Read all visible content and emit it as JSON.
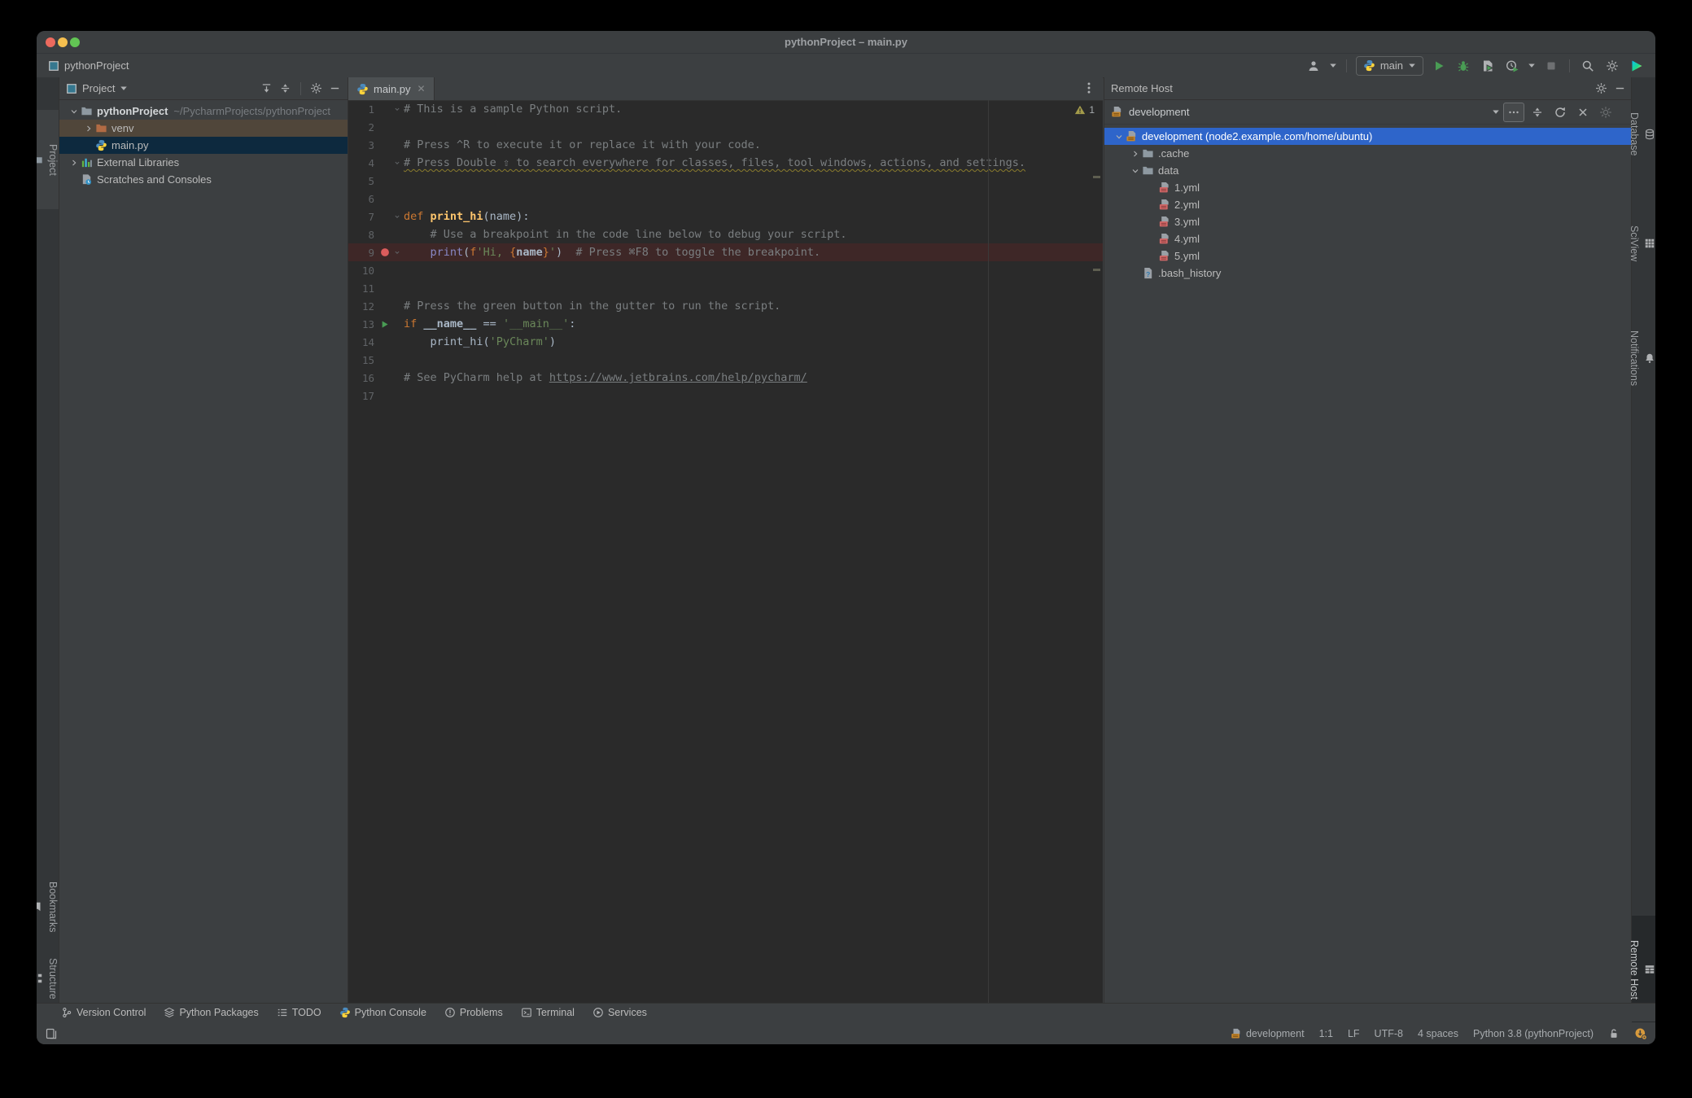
{
  "window": {
    "title": "pythonProject – main.py"
  },
  "breadcrumb": {
    "project": "pythonProject"
  },
  "toolbar": {
    "run_config": "main",
    "icons": [
      "user-icon",
      "python-icon",
      "run-icon",
      "debug-icon",
      "run-with-coverage-icon",
      "profiler-icon",
      "stop-icon",
      "search-everywhere-icon",
      "settings-gear-icon",
      "ide-logo-icon"
    ]
  },
  "left_stripe": {
    "items": [
      {
        "label": "Project",
        "icon": "folder-icon"
      },
      {
        "label": "Bookmarks",
        "icon": "bookmark-icon"
      },
      {
        "label": "Structure",
        "icon": "structure-icon"
      }
    ]
  },
  "right_stripe": {
    "items": [
      {
        "label": "Database",
        "icon": "database-icon"
      },
      {
        "label": "SciView",
        "icon": "grid-icon"
      },
      {
        "label": "Notifications",
        "icon": "bell-icon"
      }
    ],
    "bottom": [
      {
        "label": "Remote Host",
        "icon": "remote-host-icon"
      }
    ]
  },
  "project_panel": {
    "title": "Project",
    "header_icons": [
      "expand-all-icon",
      "collapse-all-icon",
      "settings-gear-icon",
      "hide-icon"
    ],
    "tree": [
      {
        "label": "pythonProject",
        "suffix": "~/PycharmProjects/pythonProject",
        "level": 0,
        "chevron": "down",
        "icon": "folder",
        "bold": true,
        "row": ""
      },
      {
        "label": "venv",
        "suffix": "",
        "level": 1,
        "chevron": "right",
        "icon": "folder-ex",
        "bold": false,
        "row": "r-venv"
      },
      {
        "label": "main.py",
        "suffix": "",
        "level": 1,
        "chevron": "",
        "icon": "python",
        "bold": false,
        "row": "r-seldim"
      },
      {
        "label": "External Libraries",
        "suffix": "",
        "level": 0,
        "chevron": "right",
        "icon": "libs",
        "bold": false,
        "row": ""
      },
      {
        "label": "Scratches and Consoles",
        "suffix": "",
        "level": 0,
        "chevron": "",
        "icon": "scratch",
        "bold": false,
        "row": ""
      }
    ]
  },
  "editor": {
    "tab": "main.py",
    "warning_count": "1",
    "lines": [
      {
        "n": "1",
        "fold": true,
        "gutter": "",
        "bg": "",
        "seg": [
          {
            "t": "# This is a sample Python script.",
            "c": "com"
          }
        ]
      },
      {
        "n": "2",
        "fold": false,
        "gutter": "",
        "bg": "",
        "seg": []
      },
      {
        "n": "3",
        "fold": false,
        "gutter": "",
        "bg": "",
        "seg": [
          {
            "t": "# Press ^R to execute it or replace it with your code.",
            "c": "com"
          }
        ]
      },
      {
        "n": "4",
        "fold": true,
        "gutter": "",
        "bg": "",
        "seg": [
          {
            "t": "# Press Double ⇧ to search everywhere for classes, files, tool windows, actions, and settings.",
            "c": "com wavy"
          }
        ]
      },
      {
        "n": "5",
        "fold": false,
        "gutter": "",
        "bg": "",
        "seg": []
      },
      {
        "n": "6",
        "fold": false,
        "gutter": "",
        "bg": "",
        "seg": []
      },
      {
        "n": "7",
        "fold": true,
        "gutter": "",
        "bg": "",
        "seg": [
          {
            "t": "def ",
            "c": "kw"
          },
          {
            "t": "print_hi",
            "c": "fn"
          },
          {
            "t": "(name):",
            "c": "pl"
          }
        ]
      },
      {
        "n": "8",
        "fold": false,
        "gutter": "",
        "bg": "",
        "seg": [
          {
            "t": "    # Use a breakpoint in the code line below to debug your script.",
            "c": "com"
          }
        ]
      },
      {
        "n": "9",
        "fold": true,
        "gutter": "breakpoint",
        "bg": "bp",
        "seg": [
          {
            "t": "    ",
            "c": "pl"
          },
          {
            "t": "print",
            "c": "bi"
          },
          {
            "t": "(",
            "c": "pl"
          },
          {
            "t": "f",
            "c": "kw"
          },
          {
            "t": "'Hi, ",
            "c": "str"
          },
          {
            "t": "{",
            "c": "kw"
          },
          {
            "t": "name",
            "c": "bb"
          },
          {
            "t": "}",
            "c": "kw"
          },
          {
            "t": "'",
            "c": "str"
          },
          {
            "t": ")",
            "c": "pl"
          },
          {
            "t": "  # Press ⌘F8 to toggle the breakpoint.",
            "c": "com"
          }
        ]
      },
      {
        "n": "10",
        "fold": false,
        "gutter": "",
        "bg": "",
        "seg": []
      },
      {
        "n": "11",
        "fold": false,
        "gutter": "",
        "bg": "",
        "seg": []
      },
      {
        "n": "12",
        "fold": false,
        "gutter": "",
        "bg": "",
        "seg": [
          {
            "t": "# Press the green button in the gutter to run the script.",
            "c": "com"
          }
        ]
      },
      {
        "n": "13",
        "fold": false,
        "gutter": "run",
        "bg": "",
        "seg": [
          {
            "t": "if ",
            "c": "kw"
          },
          {
            "t": "__name__",
            "c": "bb"
          },
          {
            "t": " == ",
            "c": "pl"
          },
          {
            "t": "'__main__'",
            "c": "str"
          },
          {
            "t": ":",
            "c": "pl"
          }
        ]
      },
      {
        "n": "14",
        "fold": false,
        "gutter": "",
        "bg": "",
        "seg": [
          {
            "t": "    print_hi(",
            "c": "pl"
          },
          {
            "t": "'PyCharm'",
            "c": "str"
          },
          {
            "t": ")",
            "c": "pl"
          }
        ]
      },
      {
        "n": "15",
        "fold": false,
        "gutter": "",
        "bg": "",
        "seg": []
      },
      {
        "n": "16",
        "fold": false,
        "gutter": "",
        "bg": "",
        "seg": [
          {
            "t": "# See PyCharm help at ",
            "c": "com"
          },
          {
            "t": "https://www.jetbrains.com/help/pycharm/",
            "c": "com link"
          }
        ]
      },
      {
        "n": "17",
        "fold": false,
        "gutter": "",
        "bg": "",
        "seg": []
      }
    ]
  },
  "remote_host": {
    "title": "Remote Host",
    "combo": "development",
    "toolbar_icons": [
      "dropdown-arrow-icon",
      "more-icon",
      "collapse-all-icon",
      "refresh-icon",
      "close-icon",
      "settings-gear-icon"
    ],
    "tree": [
      {
        "label": "development (node2.example.com/home/ubuntu)",
        "level": 0,
        "chevron": "down",
        "icon": "sftp",
        "row": "r-selblue"
      },
      {
        "label": ".cache",
        "level": 1,
        "chevron": "right",
        "icon": "folder",
        "row": ""
      },
      {
        "label": "data",
        "level": 1,
        "chevron": "down",
        "icon": "folder",
        "row": ""
      },
      {
        "label": "1.yml",
        "level": 2,
        "chevron": "",
        "icon": "yml",
        "row": ""
      },
      {
        "label": "2.yml",
        "level": 2,
        "chevron": "",
        "icon": "yml",
        "row": ""
      },
      {
        "label": "3.yml",
        "level": 2,
        "chevron": "",
        "icon": "yml",
        "row": ""
      },
      {
        "label": "4.yml",
        "level": 2,
        "chevron": "",
        "icon": "yml",
        "row": ""
      },
      {
        "label": "5.yml",
        "level": 2,
        "chevron": "",
        "icon": "yml",
        "row": ""
      },
      {
        "label": ".bash_history",
        "level": 1,
        "chevron": "",
        "icon": "fileq",
        "row": ""
      }
    ]
  },
  "bottom_bar": {
    "items": [
      {
        "label": "Version Control",
        "icon": "branch-icon"
      },
      {
        "label": "Python Packages",
        "icon": "packages-icon"
      },
      {
        "label": "TODO",
        "icon": "todo-list-icon"
      },
      {
        "label": "Python Console",
        "icon": "python-icon"
      },
      {
        "label": "Problems",
        "icon": "problems-icon"
      },
      {
        "label": "Terminal",
        "icon": "terminal-icon"
      },
      {
        "label": "Services",
        "icon": "services-icon"
      }
    ]
  },
  "status_bar": {
    "host": "development",
    "caret": "1:1",
    "line_separator": "LF",
    "encoding": "UTF-8",
    "indent": "4 spaces",
    "interpreter": "Python 3.8 (pythonProject)",
    "icons": [
      "sftp-icon",
      "lock-open-icon",
      "update-icon",
      "tool-window-switcher-icon"
    ]
  },
  "colors": {
    "selection_blue": "#2E65CA",
    "selection_dim": "#0D293E",
    "breakpoint_red": "#DB5C5C",
    "run_green": "#499C54",
    "editor_bg": "#2A2A2A",
    "panel_bg": "#3C3F41"
  }
}
